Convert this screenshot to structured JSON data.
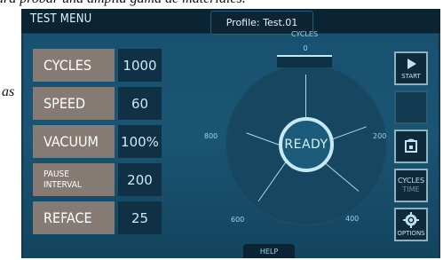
{
  "overlay_text": {
    "top": "ara probar una amplia gama de materiales.",
    "side": "as"
  },
  "header": {
    "title": "TEST MENU",
    "profile": "Profile: Test.01"
  },
  "settings": [
    {
      "label": "CYCLES",
      "value": "1000"
    },
    {
      "label": "SPEED",
      "value": "60"
    },
    {
      "label": "VACUUM",
      "value": "100%"
    },
    {
      "label": "PAUSE\nINTERVAL",
      "value": "200"
    },
    {
      "label": "REFACE",
      "value": "25"
    }
  ],
  "dial": {
    "title": "CYCLES",
    "status": "READY",
    "ticks": [
      "0",
      "200",
      "400",
      "600",
      "800"
    ]
  },
  "buttons": {
    "start": "START",
    "cycles": "CYCLES",
    "time": "TIME",
    "options": "OPTIONS"
  },
  "footer": {
    "help": "HELP"
  },
  "colors": {
    "panel": "#18516f",
    "header": "#0b2433",
    "accent": "#c7e9f6",
    "label_bg": "#867a74"
  }
}
